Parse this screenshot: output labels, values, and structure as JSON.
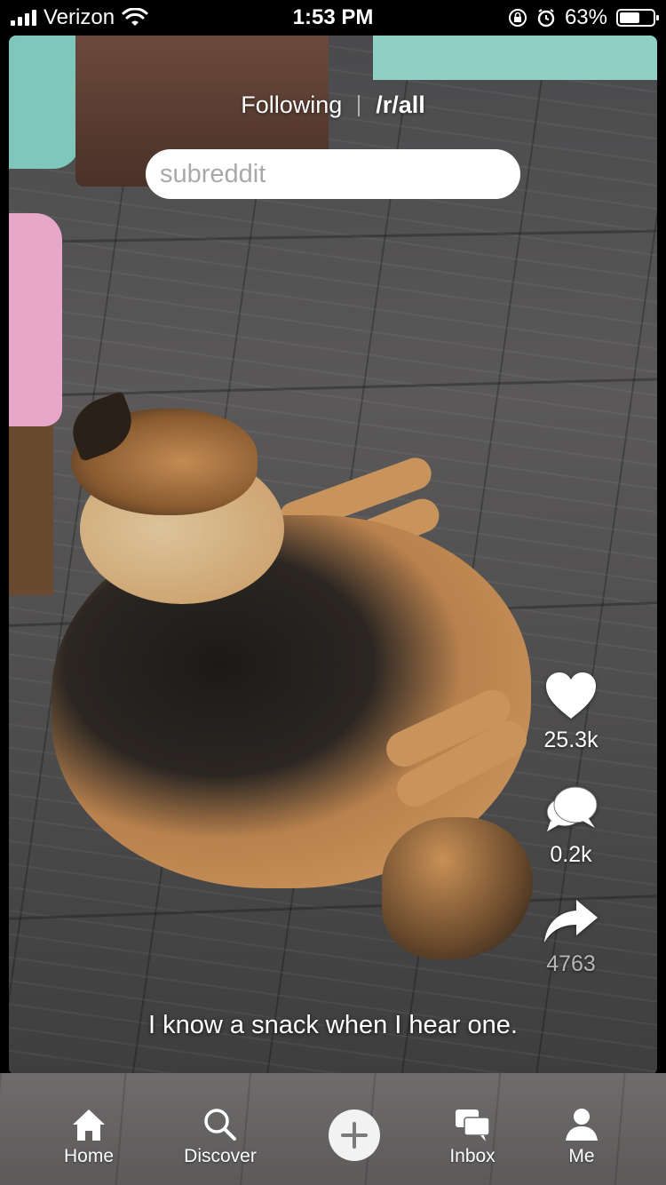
{
  "status_bar": {
    "carrier": "Verizon",
    "time": "1:53 PM",
    "battery_percent": "63%",
    "battery_level": 0.63,
    "icons": [
      "signal-icon",
      "wifi-icon",
      "rotation-lock-icon",
      "alarm-icon",
      "battery-icon"
    ]
  },
  "feed_tabs": {
    "following": "Following",
    "all": "/r/all",
    "active": "all"
  },
  "search": {
    "placeholder": "subreddit",
    "value": ""
  },
  "actions": {
    "likes": "25.3k",
    "comments": "0.2k",
    "shares": "4763",
    "icons": [
      "heart-icon",
      "comment-icon",
      "share-icon"
    ]
  },
  "post": {
    "caption": "I know a snack when I hear one."
  },
  "tab_bar": {
    "home": "Home",
    "discover": "Discover",
    "inbox": "Inbox",
    "me": "Me",
    "icons": [
      "home-icon",
      "search-icon",
      "plus-icon",
      "inbox-icon",
      "person-icon"
    ]
  },
  "colors": {
    "text": "#ffffff",
    "search_bg": "#ffffff",
    "placeholder": "#a9a9a9",
    "status_bar_bg": "#000000"
  }
}
